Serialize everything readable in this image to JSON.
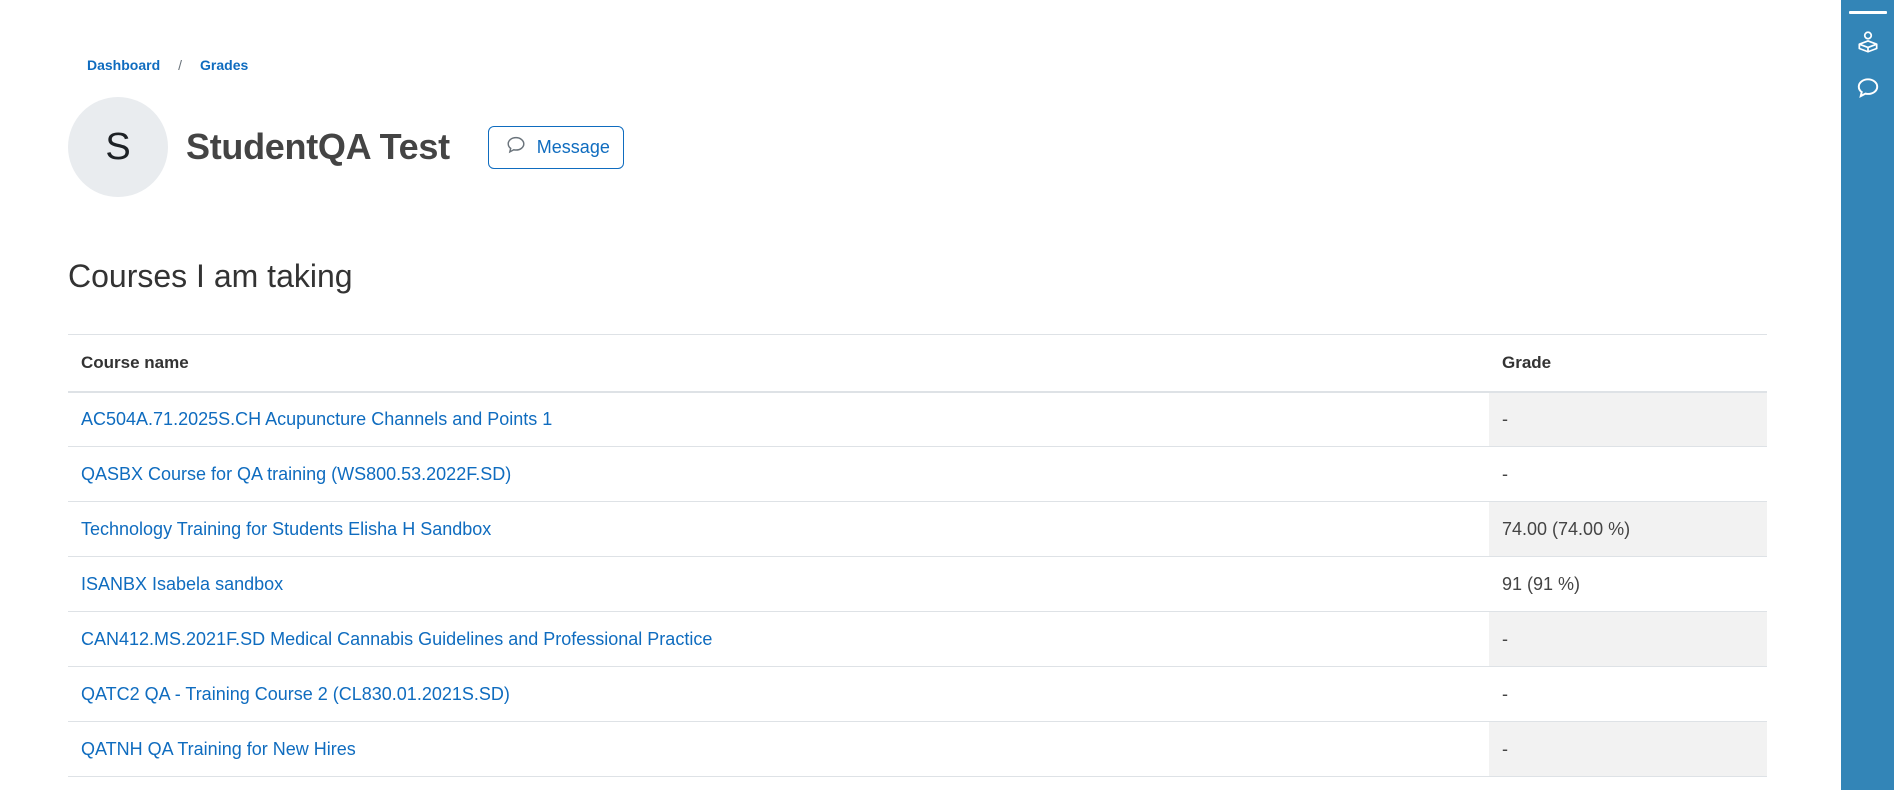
{
  "breadcrumb": {
    "items": [
      "Dashboard",
      "Grades"
    ],
    "separator": "/"
  },
  "user": {
    "initial": "S",
    "name": "StudentQA Test",
    "message_label": "Message"
  },
  "section_title": "Courses I am taking",
  "table": {
    "headers": {
      "course": "Course name",
      "grade": "Grade"
    },
    "rows": [
      {
        "course": "AC504A.71.2025S.CH Acupuncture Channels and Points 1",
        "grade": "-"
      },
      {
        "course": "QASBX Course for QA training (WS800.53.2022F.SD)",
        "grade": "-"
      },
      {
        "course": "Technology Training for Students Elisha H Sandbox",
        "grade": "74.00 (74.00 %)"
      },
      {
        "course": "ISANBX Isabela sandbox",
        "grade": "91 (91 %)"
      },
      {
        "course": "CAN412.MS.2021F.SD Medical Cannabis Guidelines and Professional Practice",
        "grade": "-"
      },
      {
        "course": "QATC2 QA - Training Course 2 (CL830.01.2021S.SD)",
        "grade": "-"
      },
      {
        "course": "QATNH QA Training for New Hires",
        "grade": "-"
      }
    ]
  },
  "drawer": {
    "icons": [
      "course-index-icon",
      "chat-bubble-icon"
    ]
  },
  "colors": {
    "link": "#0f6cbf",
    "drawer": "#3385b7",
    "stripe": "#f2f2f2"
  }
}
